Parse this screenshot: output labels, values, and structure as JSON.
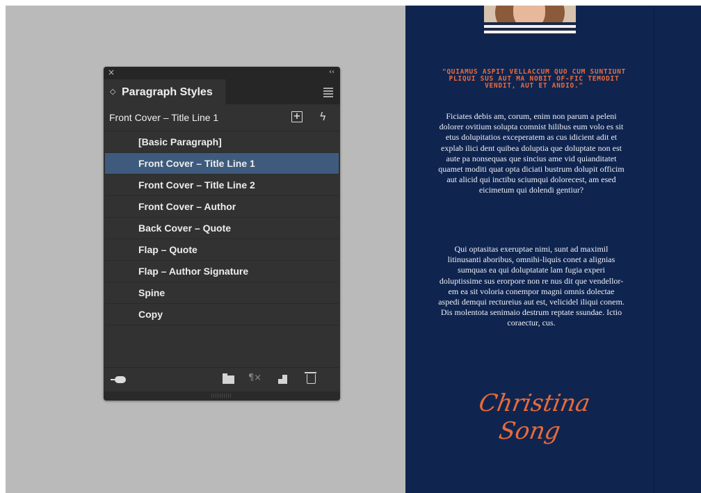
{
  "panel": {
    "tab_label": "Paragraph Styles",
    "current_style": "Front Cover – Title Line 1",
    "close_glyph": "×",
    "collapse_glyph": "‹‹",
    "tab_chevron": "◇",
    "new_from_selection_glyph": "+",
    "lightning_glyph": "ϟ",
    "pilcrow_glyph": "¶×",
    "styles": [
      {
        "label": "[Basic Paragraph]",
        "selected": false
      },
      {
        "label": "Front Cover – Title Line 1",
        "selected": true
      },
      {
        "label": "Front Cover – Title Line 2",
        "selected": false
      },
      {
        "label": "Front Cover – Author",
        "selected": false
      },
      {
        "label": "Back Cover – Quote",
        "selected": false
      },
      {
        "label": "Flap – Quote",
        "selected": false
      },
      {
        "label": "Flap – Author Signature",
        "selected": false
      },
      {
        "label": "Spine",
        "selected": false
      },
      {
        "label": "Copy",
        "selected": false
      }
    ],
    "footer_icons": [
      "cloud-library-icon",
      "folder-icon",
      "clear-overrides-icon",
      "new-style-icon",
      "trash-icon"
    ]
  },
  "document": {
    "quote": "\"QUIAMUS ASPIT VELLACCUM QUO CUM SUNTIUNT PLIQUI SUS AUT MA NOBIT OF-FIC TEMODIT VENDIT, AUT ET ANDIO.\"",
    "paragraph1": "Ficiates debis am, corum, enim non parum a peleni dolorer ovitium solupta comnist hilibus eum volo es sit etus dolupitatios exceperatem as cus idicient adit et explab ilici dent quibea doluptia que doluptate non est aute pa nonsequas que sincius ame vid quianditatet quamet moditi quat opta diciati bustrum dolupit officim aut alicid qui inctibu sciumqui dolorecest, am esed eicimetum qui dolendi gentiur?",
    "paragraph2": "Qui optasitas exeruptae nimi, sunt ad maximil litinusanti aboribus, omnihi-liquis conet a alignias sumquas ea qui doluptatate lam fugia experi doluptissime sus erorpore non re nus dit que vendellor-em ea sit voloria conempor magni omnis dolectae aspedi demqui rectureius aut est, velicidel iliqui conem. Dis molentota senimaio destrum reptate ssundae. Ictio coraectur, cus.",
    "signature": "Christina Song"
  },
  "colors": {
    "pasteboard": "#bababa",
    "cover": "#0f2550",
    "accent": "#ee6b3b",
    "panel_bg": "#323232",
    "selection": "#3e5b7d"
  }
}
